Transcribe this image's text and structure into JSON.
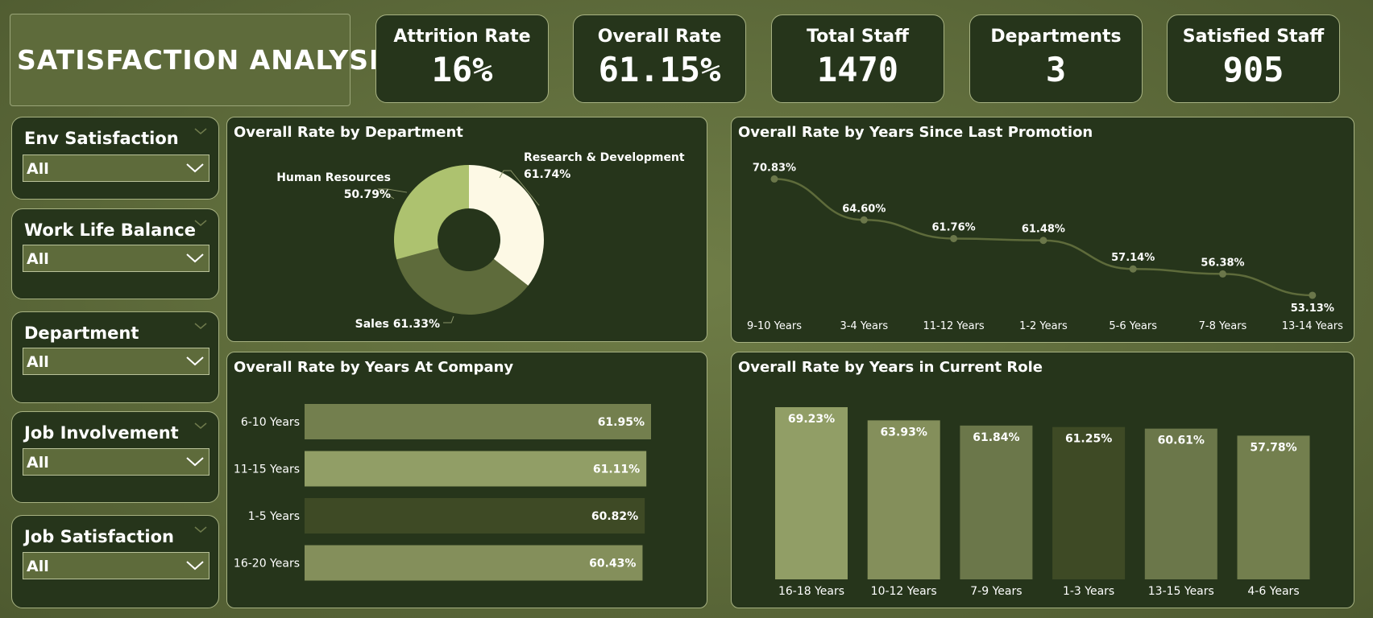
{
  "header": {
    "title": "SATISFACTION ANALYSIS"
  },
  "kpis": [
    {
      "label": "Attrition Rate",
      "value": "16%"
    },
    {
      "label": "Overall Rate",
      "value": "61.15%"
    },
    {
      "label": "Total Staff",
      "value": "1470"
    },
    {
      "label": "Departments",
      "value": "3"
    },
    {
      "label": "Satisfied Staff",
      "value": "905"
    }
  ],
  "slicers": [
    {
      "title": "Env Satisfaction",
      "selected": "All"
    },
    {
      "title": "Work Life Balance",
      "selected": "All"
    },
    {
      "title": "Department",
      "selected": "All"
    },
    {
      "title": "Job Involvement",
      "selected": "All"
    },
    {
      "title": "Job Satisfaction",
      "selected": "All"
    }
  ],
  "colors": {
    "background": "#5d6a3a",
    "panel": "#26351b",
    "border": "#a7b282"
  },
  "icons": {
    "slicer_collapse": "chevron-down-icon",
    "dropdown": "chevron-down-icon"
  },
  "chart_data": [
    {
      "type": "pie",
      "title": "Overall Rate by Department",
      "donut": true,
      "categories": [
        "Research & Development",
        "Sales",
        "Human Resources"
      ],
      "values": [
        61.74,
        61.33,
        50.79
      ],
      "labels": [
        "61.74%",
        "61.33%",
        "50.79%"
      ],
      "colors": [
        "#fdf9e5",
        "#5e6b3b",
        "#adc26f"
      ]
    },
    {
      "type": "line",
      "title": "Overall Rate by Years Since Last Promotion",
      "categories": [
        "9-10 Years",
        "3-4 Years",
        "11-12 Years",
        "1-2 Years",
        "5-6 Years",
        "7-8 Years",
        "13-14 Years"
      ],
      "values": [
        70.83,
        64.6,
        61.76,
        61.48,
        57.14,
        56.38,
        53.13
      ],
      "labels": [
        "70.83%",
        "64.60%",
        "61.76%",
        "61.48%",
        "57.14%",
        "56.38%",
        "53.13%"
      ],
      "color": "#5e6b3b"
    },
    {
      "type": "bar",
      "orientation": "horizontal",
      "title": "Overall Rate by Years At Company",
      "categories": [
        "6-10 Years",
        "11-15 Years",
        "1-5 Years",
        "16-20 Years"
      ],
      "values": [
        61.95,
        61.11,
        60.82,
        60.43
      ],
      "labels": [
        "61.95%",
        "61.11%",
        "60.82%",
        "60.43%"
      ],
      "colors": [
        "#737f4e",
        "#919e66",
        "#3e4a25",
        "#848f5b"
      ]
    },
    {
      "type": "bar",
      "orientation": "vertical",
      "title": "Overall Rate by Years in Current Role",
      "categories": [
        "16-18 Years",
        "10-12 Years",
        "7-9 Years",
        "1-3 Years",
        "13-15 Years",
        "4-6 Years"
      ],
      "values": [
        69.23,
        63.93,
        61.84,
        61.25,
        60.61,
        57.78
      ],
      "labels": [
        "69.23%",
        "63.93%",
        "61.84%",
        "61.25%",
        "60.61%",
        "57.78%"
      ],
      "colors": [
        "#919e66",
        "#848f5b",
        "#6b774a",
        "#3e4a25",
        "#6b774a",
        "#737f4e"
      ]
    }
  ]
}
